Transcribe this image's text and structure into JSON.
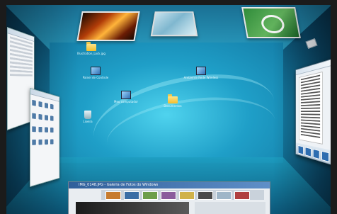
{
  "desktop": {
    "icons": [
      {
        "name": "folder-top",
        "label": "Illustration_Lock.jpg"
      },
      {
        "name": "control-panel",
        "label": "Painel de Controle"
      },
      {
        "name": "network",
        "label": "Ambiente Rede Wireless"
      },
      {
        "name": "computer",
        "label": "Meu computador"
      },
      {
        "name": "documents",
        "label": "Documentos"
      },
      {
        "name": "recycle-bin",
        "label": "Lixeira"
      }
    ]
  },
  "floor_window": {
    "title": "IMG_0148.JPG - Galeria de Fotos do Windows"
  },
  "colors": {
    "wall": "#1f9fc8",
    "frame": "#1b1b1b",
    "accent": "#2f5f9a"
  }
}
